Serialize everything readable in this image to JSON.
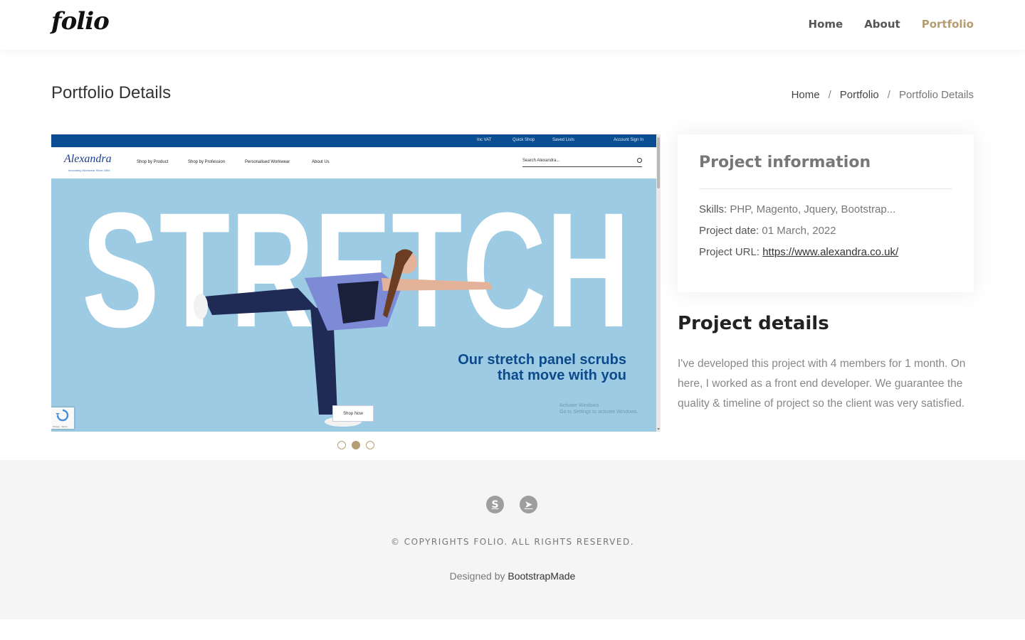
{
  "header": {
    "logo": "folio",
    "nav": [
      {
        "label": "Home",
        "active": false
      },
      {
        "label": "About",
        "active": false
      },
      {
        "label": "Portfolio",
        "active": true
      }
    ],
    "accent_color": "#b49c73"
  },
  "page": {
    "title": "Portfolio Details",
    "breadcrumb": [
      "Home",
      "Portfolio",
      "Portfolio Details"
    ]
  },
  "slider": {
    "topbar": [
      "Inc VAT",
      "Quick Shop",
      "Saved Lists",
      "Account Sign In"
    ],
    "site_logo": "Alexandra",
    "site_logo_sub": "Innovating Workwear Since 1854",
    "menu": [
      "Shop by Product",
      "Shop by Profession",
      "Personalised Workwear",
      "About Us"
    ],
    "search_placeholder": "Search Alexandra...",
    "hero_word": "STRETCH",
    "hero_line1": "Our stretch panel scrubs",
    "hero_line2": "that move with you",
    "shop_button": "Shop Now",
    "activate_line1": "Activate Windows",
    "activate_line2": "Go to Settings to activate Windows.",
    "recaptcha_text": "Privacy - Terms",
    "dots": 3,
    "active_dot": 2
  },
  "project_info": {
    "title": "Project information",
    "skills_label": "Skills:",
    "skills_value": "PHP, Magento, Jquery, Bootstrap...",
    "date_label": "Project date:",
    "date_value": "01 March, 2022",
    "url_label": "Project URL:",
    "url_value": "https://www.alexandra.co.uk/"
  },
  "project_details": {
    "title": "Project details",
    "text": "I've developed this project with 4 members for 1 month. On here, I worked as a front end developer. We guarantee the quality & timeline of project so the client was very satisfied."
  },
  "footer": {
    "socials": [
      {
        "icon": "skype-icon",
        "glyph": "S"
      },
      {
        "icon": "telegram-icon",
        "glyph": "➤"
      }
    ],
    "copyright": "© COPYRIGHTS FOLIO. ALL RIGHTS RESERVED.",
    "designed_prefix": "Designed by",
    "designed_link": "BootstrapMade"
  }
}
